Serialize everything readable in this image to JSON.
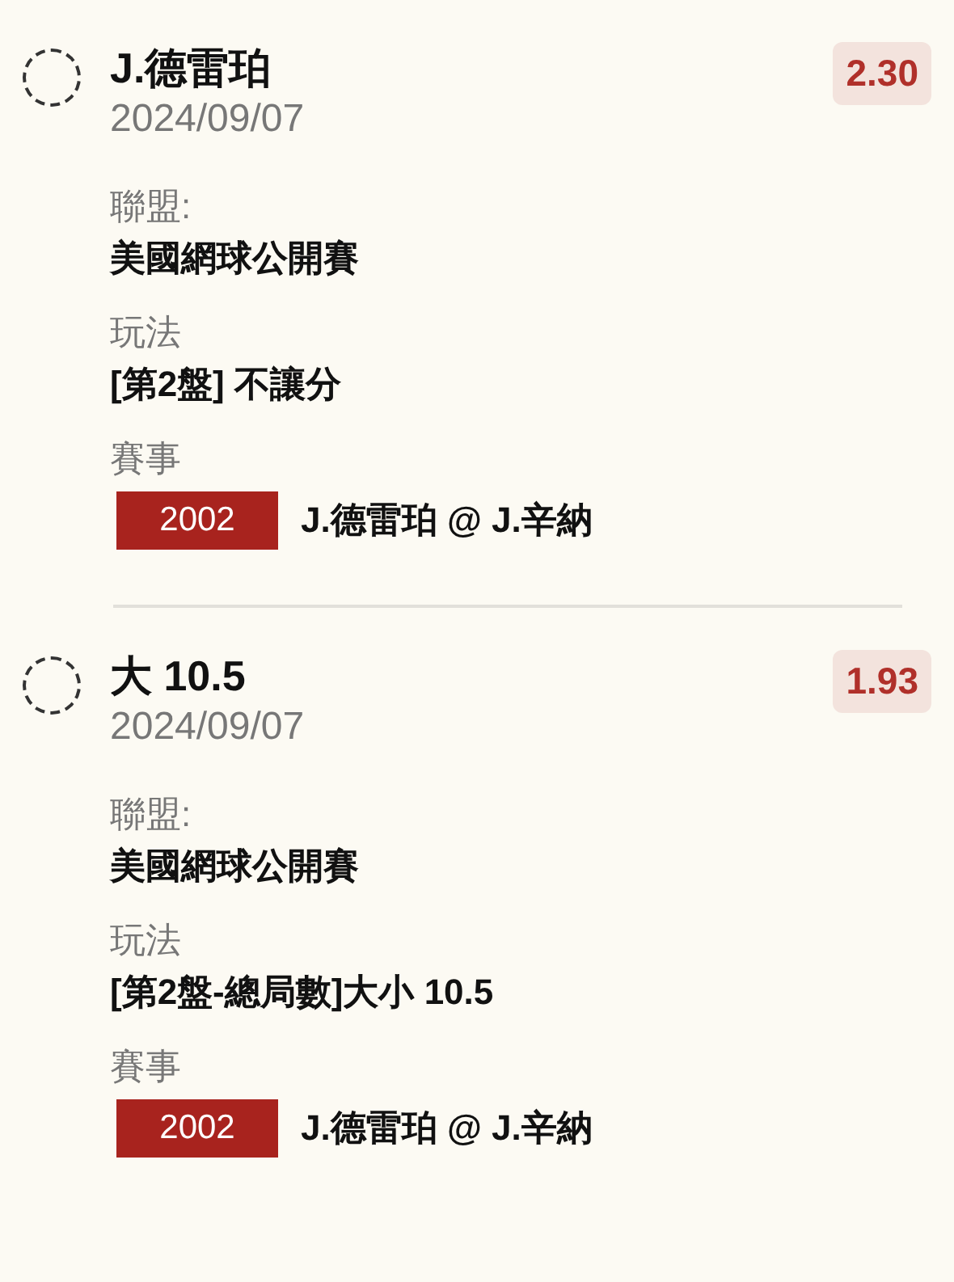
{
  "bets": [
    {
      "selected": false,
      "title": "J.德雷珀",
      "date": "2024/09/07",
      "odds": "2.30",
      "league_label": "聯盟:",
      "league": "美國網球公開賽",
      "market_label": "玩法",
      "market": "[第2盤] 不讓分",
      "event_label": "賽事",
      "event_code": "2002",
      "event": "J.德雷珀 @ J.辛納"
    },
    {
      "selected": false,
      "title": "大 10.5",
      "date": "2024/09/07",
      "odds": "1.93",
      "league_label": "聯盟:",
      "league": "美國網球公開賽",
      "market_label": "玩法",
      "market": "[第2盤-總局數]大小 10.5",
      "event_label": "賽事",
      "event_code": "2002",
      "event": "J.德雷珀 @ J.辛納"
    }
  ]
}
